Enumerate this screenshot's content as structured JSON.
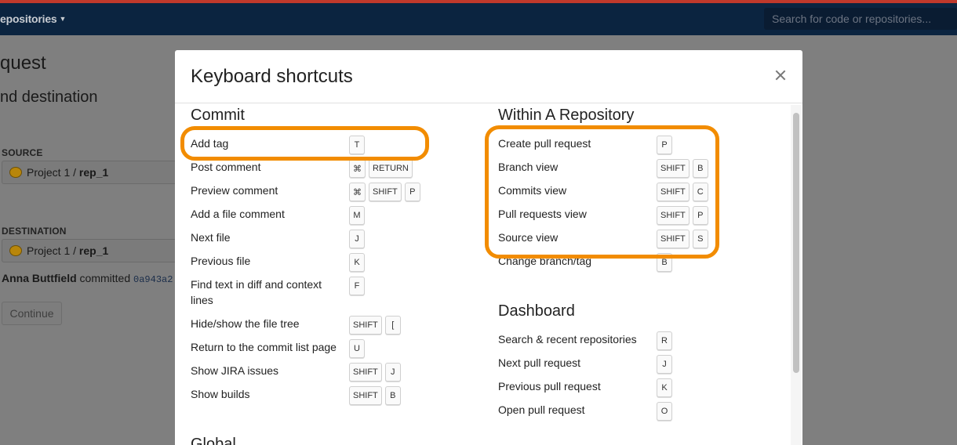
{
  "topbar": {
    "repositories_label": "epositories",
    "search_placeholder": "Search for code or repositories..."
  },
  "background": {
    "title": "quest",
    "subtitle": "nd destination",
    "source_label": "SOURCE",
    "source_project": "Project 1 /",
    "source_repo": "rep_1",
    "destination_label": "DESTINATION",
    "destination_project": "Project 1 /",
    "destination_repo": "rep_1",
    "commit_author": "Anna Buttfield",
    "commit_text": "committed",
    "commit_hash": "0a943a2",
    "continue_label": "Continue"
  },
  "modal": {
    "title": "Keyboard shortcuts",
    "commit_section": {
      "heading": "Commit",
      "rows": [
        {
          "label": "Add tag",
          "keys": [
            "T"
          ]
        },
        {
          "label": "Post comment",
          "keys": [
            "⌘",
            "RETURN"
          ]
        },
        {
          "label": "Preview comment",
          "keys": [
            "⌘",
            "SHIFT",
            "P"
          ]
        },
        {
          "label": "Add a file comment",
          "keys": [
            "M"
          ]
        },
        {
          "label": "Next file",
          "keys": [
            "J"
          ]
        },
        {
          "label": "Previous file",
          "keys": [
            "K"
          ]
        },
        {
          "label": "Find text in diff and context lines",
          "keys": [
            "F"
          ]
        },
        {
          "label": "Hide/show the file tree",
          "keys": [
            "SHIFT",
            "["
          ]
        },
        {
          "label": "Return to the commit list page",
          "keys": [
            "U"
          ]
        },
        {
          "label": "Show JIRA issues",
          "keys": [
            "SHIFT",
            "J"
          ]
        },
        {
          "label": "Show builds",
          "keys": [
            "SHIFT",
            "B"
          ]
        }
      ]
    },
    "global_heading": "Global",
    "repository_section": {
      "heading": "Within A Repository",
      "rows": [
        {
          "label": "Create pull request",
          "keys": [
            "P"
          ]
        },
        {
          "label": "Branch view",
          "keys": [
            "SHIFT",
            "B"
          ]
        },
        {
          "label": "Commits view",
          "keys": [
            "SHIFT",
            "C"
          ]
        },
        {
          "label": "Pull requests view",
          "keys": [
            "SHIFT",
            "P"
          ]
        },
        {
          "label": "Source view",
          "keys": [
            "SHIFT",
            "S"
          ]
        },
        {
          "label": "Change branch/tag",
          "keys": [
            "B"
          ]
        }
      ]
    },
    "dashboard_section": {
      "heading": "Dashboard",
      "rows": [
        {
          "label": "Search & recent repositories",
          "keys": [
            "R"
          ]
        },
        {
          "label": "Next pull request",
          "keys": [
            "J"
          ]
        },
        {
          "label": "Previous pull request",
          "keys": [
            "K"
          ]
        },
        {
          "label": "Open pull request",
          "keys": [
            "O"
          ]
        }
      ]
    }
  },
  "colors": {
    "highlight": "#f28c00",
    "topbar": "#0b2440",
    "accent_stripe": "#c0392b",
    "overlay": "#7f7f7f"
  }
}
